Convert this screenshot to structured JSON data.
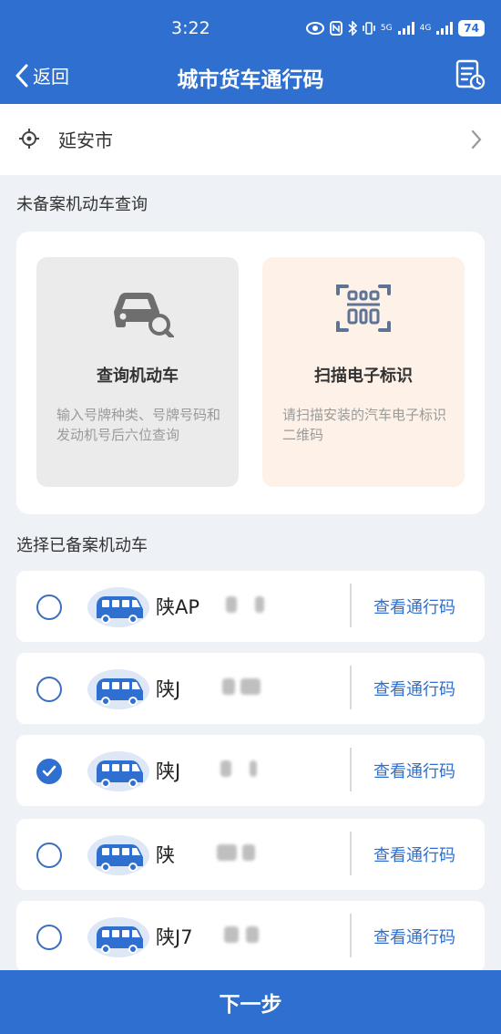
{
  "status_bar": {
    "time": "3:22",
    "signal_1": "5G",
    "signal_2": "4G",
    "battery": "74"
  },
  "nav": {
    "back_label": "返回",
    "title": "城市货车通行码"
  },
  "city": {
    "name": "延安市"
  },
  "unregistered": {
    "section_title": "未备案机动车查询",
    "options": [
      {
        "title": "查询机动车",
        "description": "输入号牌种类、号牌号码和发动机号后六位查询",
        "icon": "car-search-icon"
      },
      {
        "title": "扫描电子标识",
        "description": "请扫描安装的汽车电子标识二维码",
        "icon": "qr-scan-icon"
      }
    ]
  },
  "registered": {
    "section_title": "选择已备案机动车",
    "view_label": "查看通行码",
    "vehicles": [
      {
        "plate": "陕AP",
        "selected": false
      },
      {
        "plate": "陕J",
        "selected": false
      },
      {
        "plate": "陕J",
        "selected": true
      },
      {
        "plate": "陕",
        "selected": false
      },
      {
        "plate": "陕J7",
        "selected": false
      }
    ]
  },
  "footer": {
    "next_label": "下一步"
  },
  "colors": {
    "primary": "#2f6fd0",
    "background": "#eef1f6",
    "peach": "#fdf1e8",
    "gray_card": "#ebebeb"
  }
}
